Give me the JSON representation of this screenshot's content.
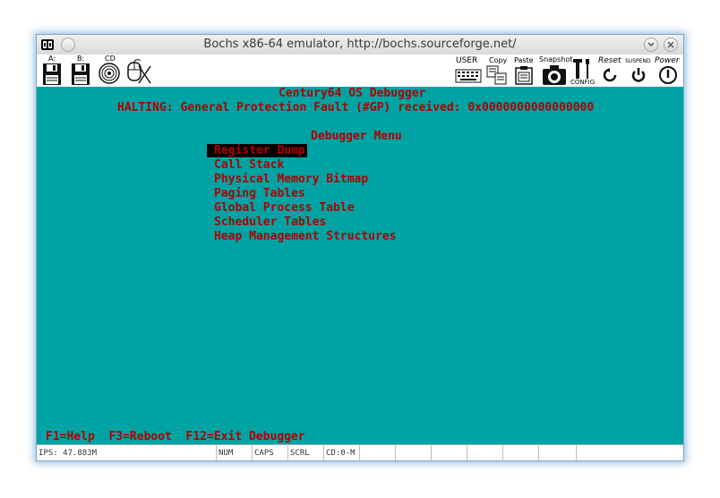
{
  "window": {
    "title": "Bochs x86-64 emulator, http://bochs.sourceforge.net/"
  },
  "toolbar": {
    "floppy_a_label": "A:",
    "floppy_b_label": "B:",
    "cdrom_label": "CD",
    "user_label": "USER",
    "copy_label": "Copy",
    "paste_label": "Paste",
    "snapshot_label": "Snapshot",
    "config_label": "CONFIG",
    "reset_label": "Reset",
    "suspend_label": "SUSPEND",
    "power_label": "Power"
  },
  "screen": {
    "header_title": "Century64 OS Debugger",
    "halt_message": "HALTING: General Protection Fault (#GP) received: 0x0000000000000000",
    "menu_title": "Debugger Menu",
    "menu_items": [
      "Register Dump",
      "Call Stack",
      "Physical Memory Bitmap",
      "Paging Tables",
      "Global Process Table",
      "Scheduler Tables",
      "Heap Management Structures"
    ],
    "selected_index": 0,
    "footer": "F1=Help  F3=Reboot  F12=Exit Debugger"
  },
  "statusbar": {
    "ips": "IPS: 47.883M",
    "num": "NUM",
    "caps": "CAPS",
    "scrl": "SCRL",
    "cd": "CD:0-M"
  },
  "colors": {
    "screen_bg": "#00a3a3",
    "text": "#b00000",
    "highlight_bg": "#000000"
  }
}
